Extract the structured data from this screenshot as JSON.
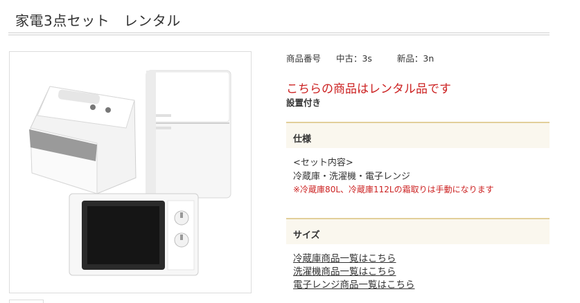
{
  "page": {
    "title": "家電3点セット　レンタル"
  },
  "product": {
    "image_alt": "冷蔵庫・洗濯機・電子レンジ",
    "code_label": "商品番号",
    "used_code": "中古：3s",
    "new_code": "新品：3n",
    "rental_notice": "こちらの商品はレンタル品です",
    "install_note": "設置付き"
  },
  "spec": {
    "header": "仕様",
    "set_contents_label": "<セット内容>",
    "set_items": "冷蔵庫・洗濯機・電子レンジ",
    "note": "※冷蔵庫80L、冷蔵庫112Lの霜取りは手動になります"
  },
  "size": {
    "header": "サイズ",
    "links": [
      "冷蔵庫商品一覧はこちら",
      "洗濯機商品一覧はこちら",
      "電子レンジ商品一覧はこちら"
    ]
  },
  "colors": {
    "notice_red": "#cc2222",
    "section_bg": "#faf7ee",
    "section_border": "#e2cf9a"
  }
}
